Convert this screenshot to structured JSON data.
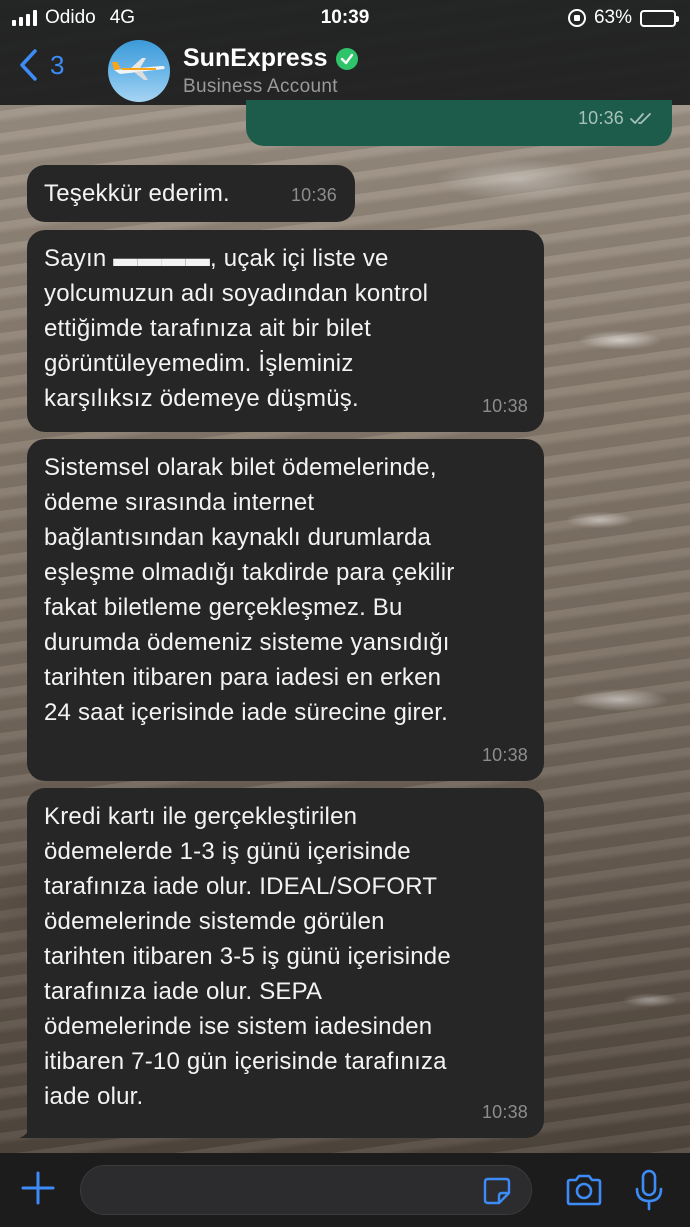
{
  "status_bar": {
    "carrier": "Odido",
    "network": "4G",
    "time": "10:39",
    "battery": "63%",
    "battery_level": 0.63
  },
  "header": {
    "back_count": "3",
    "contact_name": "SunExpress",
    "contact_subtitle": "Business Account",
    "verified_icon": "verified-check-icon"
  },
  "messages": [
    {
      "direction": "outgoing",
      "text": "",
      "time": "10:36",
      "ticks": "double-check-icon"
    },
    {
      "direction": "incoming",
      "text": "Teşekkür ederim.",
      "time": "10:36"
    },
    {
      "direction": "incoming",
      "text": "Sayın ▬▬▬▬, uçak içi liste ve\nyolcumuzun adı soyadından kontrol\nettiğimde tarafınıza ait bir bilet\ngörüntüleyemedim. İşleminiz\nkarşılıksız ödemeye düşmüş.",
      "time": "10:38"
    },
    {
      "direction": "incoming",
      "text": "Sistemsel olarak bilet ödemelerinde,\nödeme sırasında internet\nbağlantısından kaynaklı durumlarda\neşleşme olmadığı takdirde para çekilir\nfakat biletleme gerçekleşmez. Bu\ndurumda ödemeniz sisteme yansıdığı\ntarihten itibaren para iadesi en erken\n24 saat içerisinde iade sürecine girer.",
      "time": "10:38"
    },
    {
      "direction": "incoming",
      "text": "Kredi kartı ile gerçekleştirilen\nödemelerde 1-3 iş günü içerisinde\ntarafınıza iade olur. IDEAL/SOFORT\nödemelerinde sistemde görülen\ntarihten itibaren 3-5 iş günü içerisinde\ntarafınıza iade olur. SEPA\nödemelerinde ise sistem iadesinden\nitibaren 7-10 gün içerisinde tarafınıza\niade olur.",
      "time": "10:38"
    }
  ],
  "composer": {
    "value": "",
    "placeholder": ""
  },
  "colors": {
    "accent_blue": "#3d8bf7",
    "outgoing_bubble": "#1d5c4a",
    "incoming_bubble": "#262626",
    "verified_green": "#2fc46a"
  }
}
